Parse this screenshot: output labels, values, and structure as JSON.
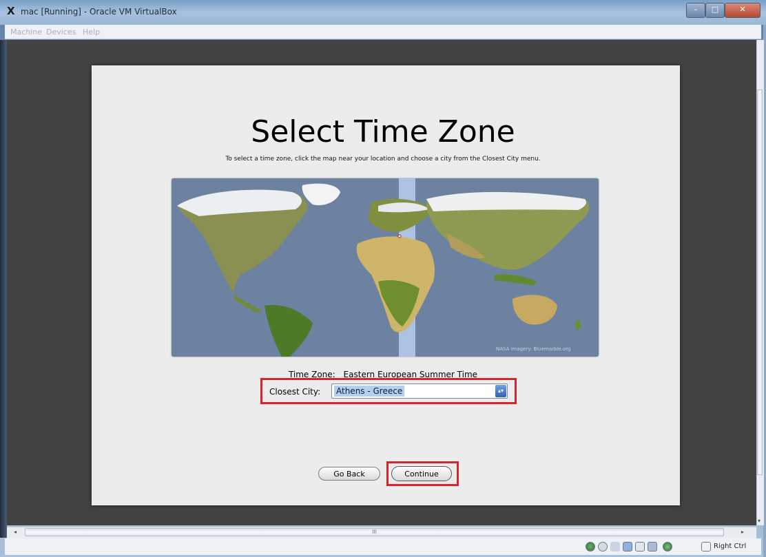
{
  "window": {
    "title": "mac [Running] - Oracle VM VirtualBox",
    "minimize_glyph": "–",
    "maximize_glyph": "□",
    "close_glyph": "✕"
  },
  "menu": {
    "items": [
      "Machine",
      "Devices",
      "Help"
    ]
  },
  "installer": {
    "title": "Select Time Zone",
    "subtitle": "To select a time zone, click the map near your location and choose a city from the Closest City menu.",
    "map_credit": "NASA imagery: Bluemarble.org",
    "time_zone_label": "Time Zone:",
    "time_zone_value": "Eastern European Summer Time",
    "closest_city_label": "Closest City:",
    "closest_city_value": "Athens - Greece",
    "back_button": "Go Back",
    "continue_button": "Continue"
  },
  "statusbar": {
    "host_key": "Right Ctrl",
    "icons": [
      "hard-disk-icon",
      "optical-drive-icon",
      "usb-icon",
      "network-icon",
      "shared-folders-icon",
      "display-icon",
      "mouse-integration-icon",
      "host-key-icon"
    ]
  },
  "scroll": {
    "h_thumb_glyph": "III",
    "left_arrow": "◂",
    "right_arrow": "▸",
    "down_arrow": "▾"
  },
  "colors": {
    "vm_background": "#424242",
    "panel_background": "#ececec",
    "highlight_red": "#d8232a",
    "map_ocean": "#6d82a0"
  }
}
